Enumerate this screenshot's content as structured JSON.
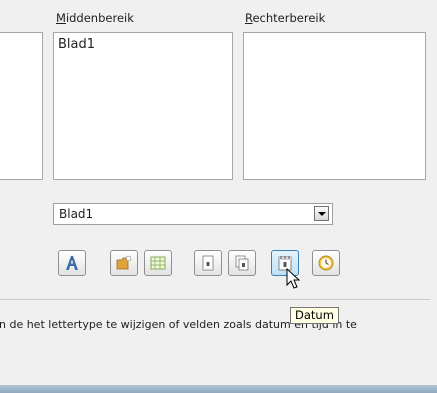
{
  "labels": {
    "middle_first": "M",
    "middle_rest": "iddenbereik",
    "right_first": "R",
    "right_rest": "echterbereik"
  },
  "panes": {
    "middle_text": "Blad1",
    "right_text": ""
  },
  "select": {
    "value": "Blad1"
  },
  "toolbar": {
    "buttons": [
      {
        "name": "text-attributes",
        "icon": "text-format-icon"
      },
      {
        "name": "filename",
        "icon": "folder-icon"
      },
      {
        "name": "sheet-name",
        "icon": "sheet-grid-icon"
      },
      {
        "name": "page-number",
        "icon": "page-number-icon"
      },
      {
        "name": "pages",
        "icon": "pages-icon"
      },
      {
        "name": "date",
        "icon": "calendar-icon"
      },
      {
        "name": "time",
        "icon": "clock-icon"
      }
    ]
  },
  "tooltip": "Datum",
  "help_text": "n de het lettertype te wijzigen of velden zoals datum en tijd in te",
  "colors": {
    "active_button": "#bfe2f8",
    "tooltip_bg": "#ffffe1"
  }
}
